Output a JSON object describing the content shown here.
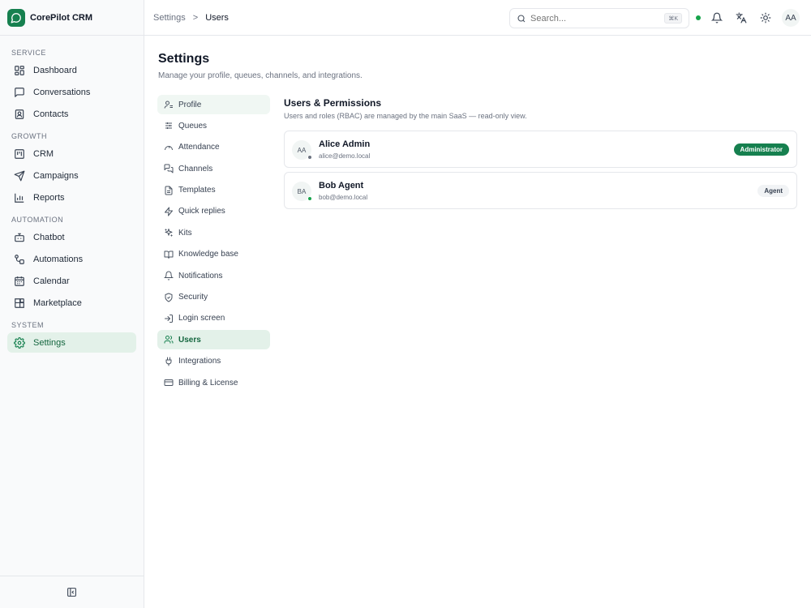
{
  "brand": {
    "name": "CorePilot CRM",
    "accent": "#16804f"
  },
  "sidebar": {
    "sections": [
      {
        "label": "SERVICE",
        "items": [
          {
            "label": "Dashboard",
            "icon": "dashboard-icon"
          },
          {
            "label": "Conversations",
            "icon": "chat-icon"
          },
          {
            "label": "Contacts",
            "icon": "contacts-icon"
          }
        ]
      },
      {
        "label": "GROWTH",
        "items": [
          {
            "label": "CRM",
            "icon": "kanban-icon"
          },
          {
            "label": "Campaigns",
            "icon": "send-icon"
          },
          {
            "label": "Reports",
            "icon": "bar-chart-icon"
          }
        ]
      },
      {
        "label": "AUTOMATION",
        "items": [
          {
            "label": "Chatbot",
            "icon": "bot-icon"
          },
          {
            "label": "Automations",
            "icon": "workflow-icon"
          },
          {
            "label": "Calendar",
            "icon": "calendar-icon"
          },
          {
            "label": "Marketplace",
            "icon": "blocks-icon"
          }
        ]
      },
      {
        "label": "SYSTEM",
        "items": [
          {
            "label": "Settings",
            "icon": "gear-icon",
            "active": true
          }
        ]
      }
    ],
    "collapse_icon": "panel-collapse-icon"
  },
  "header": {
    "breadcrumb": {
      "parent": "Settings",
      "separator": ">",
      "current": "Users"
    },
    "search": {
      "placeholder": "Search...",
      "shortcut": "⌘K"
    },
    "status_color": "#16a34a",
    "avatar_initials": "AA"
  },
  "page": {
    "title": "Settings",
    "subtitle": "Manage your profile, queues, channels, and integrations."
  },
  "settings_nav": [
    {
      "label": "Profile",
      "icon": "user-icon"
    },
    {
      "label": "Queues",
      "icon": "sliders-icon"
    },
    {
      "label": "Attendance",
      "icon": "gauge-icon"
    },
    {
      "label": "Channels",
      "icon": "messages-icon"
    },
    {
      "label": "Templates",
      "icon": "file-text-icon"
    },
    {
      "label": "Quick replies",
      "icon": "zap-icon"
    },
    {
      "label": "Kits",
      "icon": "sparkles-icon"
    },
    {
      "label": "Knowledge base",
      "icon": "book-icon"
    },
    {
      "label": "Notifications",
      "icon": "bell-icon"
    },
    {
      "label": "Security",
      "icon": "shield-icon"
    },
    {
      "label": "Login screen",
      "icon": "login-icon"
    },
    {
      "label": "Users",
      "icon": "users-icon",
      "active": true
    },
    {
      "label": "Integrations",
      "icon": "plug-icon"
    },
    {
      "label": "Billing & License",
      "icon": "credit-card-icon"
    }
  ],
  "users_section": {
    "title": "Users & Permissions",
    "description": "Users and roles (RBAC) are managed by the main SaaS — read-only view.",
    "users": [
      {
        "initials": "AA",
        "name": "Alice Admin",
        "email": "alice@demo.local",
        "role": "Administrator",
        "presence_color": "#6b7280"
      },
      {
        "initials": "BA",
        "name": "Bob Agent",
        "email": "bob@demo.local",
        "role": "Agent",
        "presence_color": "#16a34a"
      }
    ]
  }
}
